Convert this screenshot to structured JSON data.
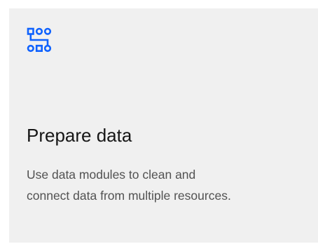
{
  "tile": {
    "icon": "data-flow-icon",
    "title": "Prepare data",
    "description": "Use data modules to clean and connect data from multiple resources."
  },
  "colors": {
    "background": "#f0f0f0",
    "accent": "#0f62fe",
    "title": "#161616",
    "description": "#525252"
  }
}
